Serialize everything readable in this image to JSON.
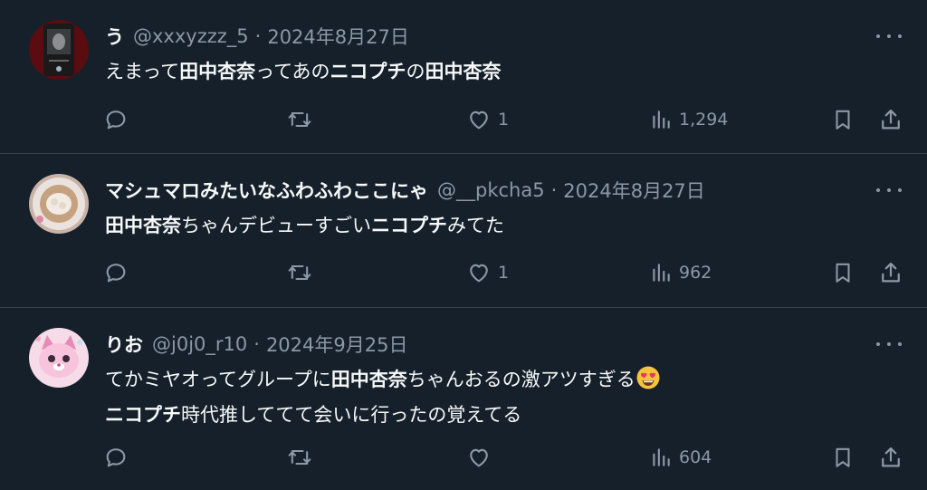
{
  "tweets": [
    {
      "name": "う",
      "handle": "@xxxyzzz_5",
      "date": "2024年8月27日",
      "lines": [
        [
          {
            "t": "えまって",
            "b": false
          },
          {
            "t": "田中杏奈",
            "b": true
          },
          {
            "t": "ってあの",
            "b": false
          },
          {
            "t": "ニコプチ",
            "b": true
          },
          {
            "t": "の",
            "b": false
          },
          {
            "t": "田中杏奈",
            "b": true
          }
        ]
      ],
      "avatar": "dark-portrait-avatar",
      "replies": "",
      "retweets": "",
      "likes": "1",
      "views": "1,294"
    },
    {
      "name": "マシュマロみたいなふわふわここにゃ",
      "handle": "@__pkcha5",
      "date": "2024年8月27日",
      "lines": [
        [
          {
            "t": "田中杏奈",
            "b": true
          },
          {
            "t": "ちゃんデビューすごい",
            "b": false
          },
          {
            "t": "ニコプチ",
            "b": true
          },
          {
            "t": "みてた",
            "b": false
          }
        ]
      ],
      "avatar": "latte-art-avatar",
      "replies": "",
      "retweets": "",
      "likes": "1",
      "views": "962"
    },
    {
      "name": "りお",
      "handle": "@j0j0_r10",
      "date": "2024年9月25日",
      "lines": [
        [
          {
            "t": "てかミヤオってグループに",
            "b": false
          },
          {
            "t": "田中杏奈",
            "b": true
          },
          {
            "t": "ちゃんおるの激アツすぎる",
            "b": false
          }
        ],
        [
          {
            "t": "ニコプチ",
            "b": true
          },
          {
            "t": "時代推しててて会いに行ったの覚えてる",
            "b": false
          }
        ]
      ],
      "line1_emoji": "heart-eyes-emoji",
      "avatar": "pink-cat-character-avatar",
      "replies": "",
      "retweets": "",
      "likes": "",
      "views": "604"
    }
  ],
  "colors": {
    "background": "#15202b",
    "divider": "#38444d",
    "text": "#f7f9f9",
    "secondary": "#8b98a5"
  }
}
